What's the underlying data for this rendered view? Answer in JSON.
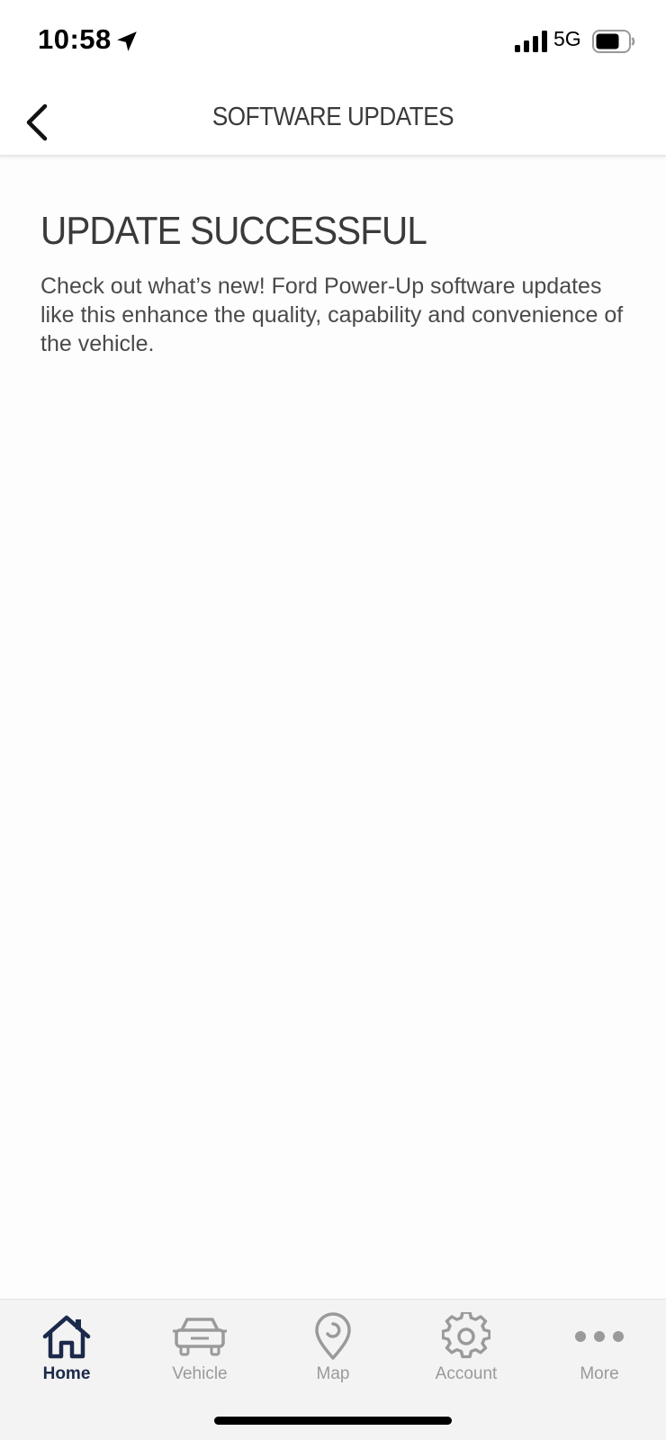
{
  "status_bar": {
    "time": "10:58",
    "network": "5G",
    "location_icon": "location-arrow-icon",
    "signal_icon": "signal-bars-icon",
    "battery_icon": "battery-icon"
  },
  "header": {
    "title": "SOFTWARE UPDATES",
    "back_icon": "chevron-left-icon"
  },
  "main": {
    "heading": "UPDATE SUCCESSFUL",
    "body": "Check out what’s new! Ford Power-Up software updates like this enhance the quality, capability and convenience of the vehicle."
  },
  "tab_bar": {
    "active_color": "#1b2a4a",
    "inactive_color": "#9a9a9a",
    "tabs": [
      {
        "label": "Home",
        "icon": "home-icon",
        "active": true
      },
      {
        "label": "Vehicle",
        "icon": "car-icon",
        "active": false
      },
      {
        "label": "Map",
        "icon": "map-pin-icon",
        "active": false
      },
      {
        "label": "Account",
        "icon": "gear-icon",
        "active": false
      },
      {
        "label": "More",
        "icon": "more-dots-icon",
        "active": false
      }
    ]
  }
}
